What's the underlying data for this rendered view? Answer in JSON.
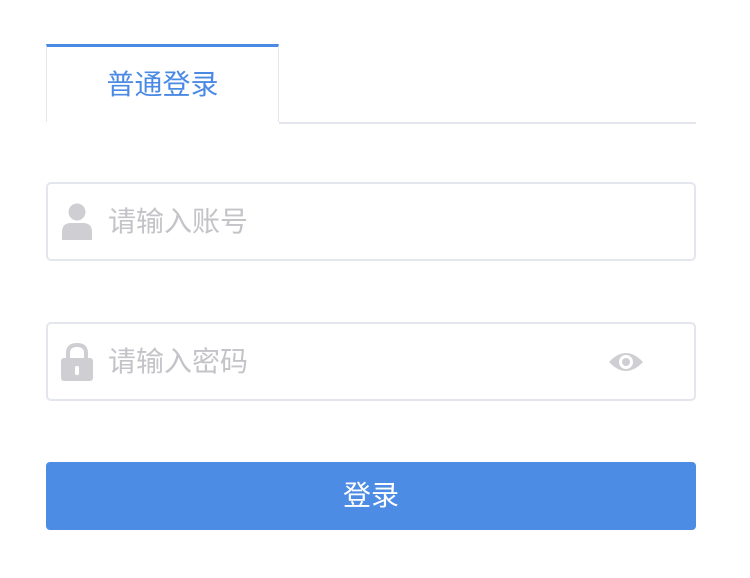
{
  "tabs": [
    {
      "label": "普通登录",
      "active": true
    }
  ],
  "account": {
    "placeholder": "请输入账号",
    "value": "",
    "icon": "user-icon"
  },
  "password": {
    "placeholder": "请输入密码",
    "value": "",
    "icon": "lock-icon",
    "toggle_icon": "eye-icon"
  },
  "login_button": {
    "label": "登录"
  },
  "colors": {
    "accent": "#4a8ae4",
    "button": "#4c8ce4",
    "border": "#e4e6ee",
    "icon": "#cfcfd3",
    "placeholder": "#c3c3c8"
  }
}
